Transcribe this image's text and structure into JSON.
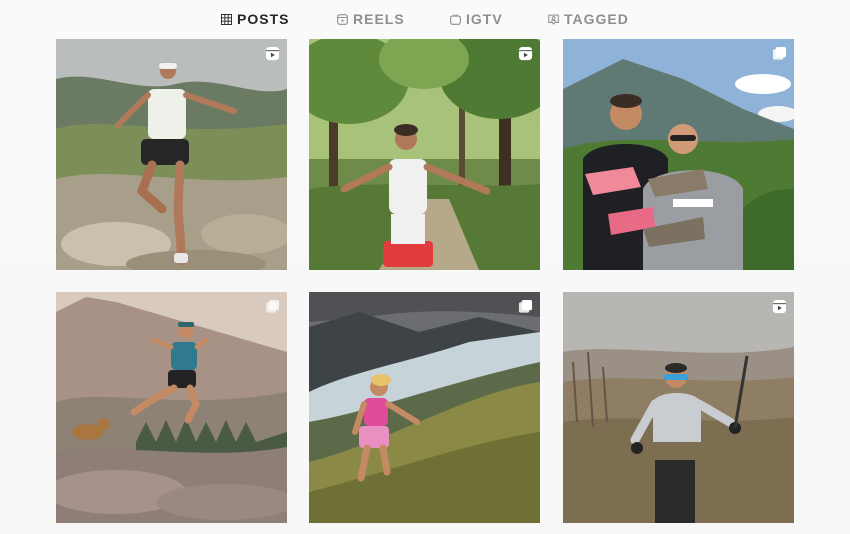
{
  "tabs": [
    {
      "label": "POSTS",
      "icon": "grid-icon",
      "active": true
    },
    {
      "label": "REELS",
      "icon": "reels-icon",
      "active": false
    },
    {
      "label": "IGTV",
      "icon": "igtv-icon",
      "active": false
    },
    {
      "label": "TAGGED",
      "icon": "tagged-icon",
      "active": false
    }
  ],
  "posts": [
    {
      "badge": "reels-icon"
    },
    {
      "badge": "reels-icon"
    },
    {
      "badge": "carousel-icon"
    },
    {
      "badge": "carousel-icon"
    },
    {
      "badge": "carousel-icon"
    },
    {
      "badge": "reels-icon"
    }
  ],
  "colors": {
    "background": "#fafafa",
    "tab_active": "#262626",
    "tab_inactive": "#8e8e8e"
  }
}
